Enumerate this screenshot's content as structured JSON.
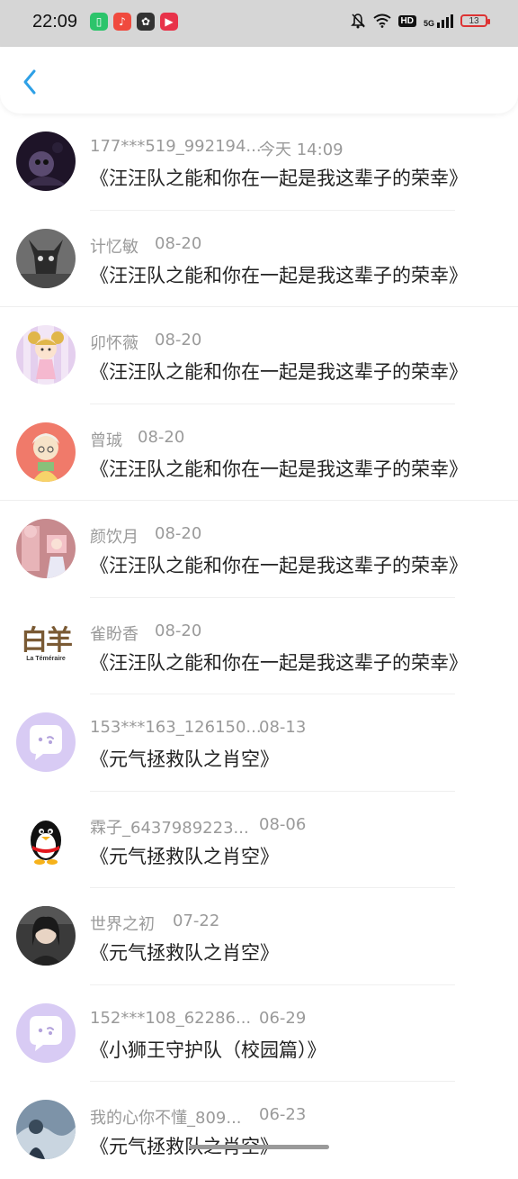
{
  "status_bar": {
    "time": "22:09",
    "hd": "HD",
    "network": "5G",
    "battery": "13"
  },
  "header": {
    "back_icon": "chevron-left-icon"
  },
  "items": [
    {
      "user": "177***519_992194...",
      "time": "今天 14:09",
      "title": "《汪汪队之能和你在一起是我这辈子的荣幸》"
    },
    {
      "user": "计忆敏",
      "time": "08-20",
      "title": "《汪汪队之能和你在一起是我这辈子的荣幸》"
    },
    {
      "user": "卯怀薇",
      "time": "08-20",
      "title": "《汪汪队之能和你在一起是我这辈子的荣幸》"
    },
    {
      "user": "曾珹",
      "time": "08-20",
      "title": "《汪汪队之能和你在一起是我这辈子的荣幸》"
    },
    {
      "user": "颜饮月",
      "time": "08-20",
      "title": "《汪汪队之能和你在一起是我这辈子的荣幸》"
    },
    {
      "user": "雀盼香",
      "time": "08-20",
      "title": "《汪汪队之能和你在一起是我这辈子的荣幸》",
      "avatar_text": "白羊",
      "avatar_sub": "La Téméraire"
    },
    {
      "user": "153***163_126150...",
      "time": "08-13",
      "title": "《元气拯救队之肖空》"
    },
    {
      "user": "霖子_6437989223...",
      "time": "08-06",
      "title": "《元气拯救队之肖空》"
    },
    {
      "user": "世界之初",
      "time": "07-22",
      "title": "《元气拯救队之肖空》"
    },
    {
      "user": "152***108_62286...",
      "time": "06-29",
      "title": "《小狮王守护队（校园篇）》"
    },
    {
      "user": "我的心你不懂_809...",
      "time": "06-23",
      "title": "《元气拯救队之肖空》"
    }
  ],
  "colors": {
    "accent": "#2ea0e6",
    "status_bg": "#d6d6d6"
  }
}
